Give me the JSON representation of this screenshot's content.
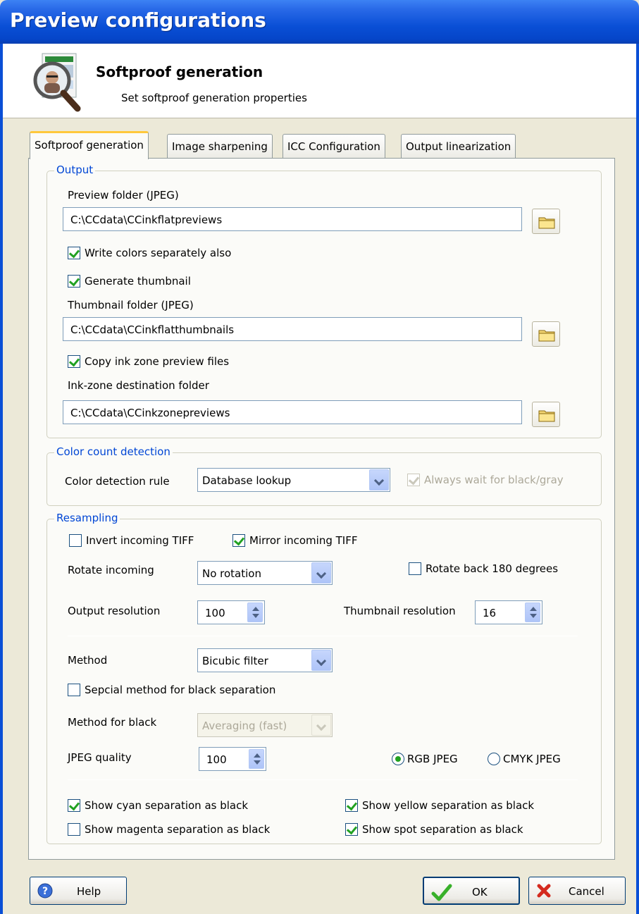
{
  "window": {
    "title": "Preview configurations"
  },
  "header": {
    "title": "Softproof generation",
    "subtitle": "Set softproof generation properties",
    "icon": "magnifier-document-icon"
  },
  "tabs": [
    {
      "label": "Softproof generation",
      "active": true
    },
    {
      "label": "Image sharpening",
      "active": false
    },
    {
      "label": "ICC Configuration",
      "active": false
    },
    {
      "label": "Output linearization",
      "active": false
    }
  ],
  "output": {
    "legend": "Output",
    "preview_folder_label": "Preview folder (JPEG)",
    "preview_folder_value": "C:\\CCdata\\CCinkflatpreviews",
    "write_colors_separately_label": "Write colors separately also",
    "write_colors_separately_checked": true,
    "generate_thumbnail_label": "Generate thumbnail",
    "generate_thumbnail_checked": true,
    "thumbnail_folder_label": "Thumbnail folder (JPEG)",
    "thumbnail_folder_value": "C:\\CCdata\\CCinkflatthumbnails",
    "copy_inkzone_label": "Copy ink zone preview files",
    "copy_inkzone_checked": true,
    "inkzone_folder_label": "Ink-zone destination folder",
    "inkzone_folder_value": "C:\\CCdata\\CCinkzonepreviews"
  },
  "color_count": {
    "legend": "Color count detection",
    "rule_label": "Color detection rule",
    "rule_value": "Database lookup",
    "wait_black_label": "Always wait for black/gray",
    "wait_black_checked": true
  },
  "resampling": {
    "legend": "Resampling",
    "invert_label": "Invert incoming TIFF",
    "invert_checked": false,
    "mirror_label": "Mirror incoming TIFF",
    "mirror_checked": true,
    "rotate_label": "Rotate incoming",
    "rotate_value": "No rotation",
    "rotate_back_label": "Rotate back 180 degrees",
    "rotate_back_checked": false,
    "output_res_label": "Output resolution",
    "output_res_value": "100",
    "thumb_res_label": "Thumbnail resolution",
    "thumb_res_value": "16",
    "method_label": "Method",
    "method_value": "Bicubic filter",
    "special_black_label": "Sepcial method for black separation",
    "special_black_checked": false,
    "method_black_label": "Method for black",
    "method_black_value": "Averaging (fast)",
    "jpeg_quality_label": "JPEG quality",
    "jpeg_quality_value": "100",
    "rgb_jpeg_label": "RGB JPEG",
    "cmyk_jpeg_label": "CMYK JPEG",
    "jpeg_mode": "RGB JPEG",
    "show_cyan_label": "Show cyan separation as black",
    "show_cyan_checked": true,
    "show_magenta_label": "Show magenta separation as black",
    "show_magenta_checked": false,
    "show_yellow_label": "Show yellow separation as black",
    "show_yellow_checked": true,
    "show_spot_label": "Show spot separation as black",
    "show_spot_checked": true
  },
  "buttons": {
    "help": "Help",
    "ok": "OK",
    "cancel": "Cancel"
  },
  "colors": {
    "titlebar": "#0a4fd6",
    "legend": "#0046d5",
    "check_mark": "#21a121",
    "window_bg": "#ece9d8"
  }
}
